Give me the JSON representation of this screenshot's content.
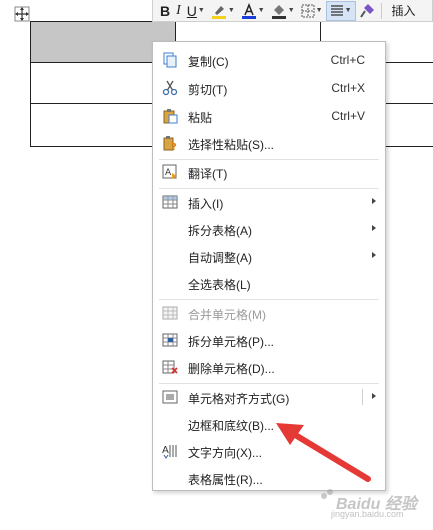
{
  "toolbar": {
    "bold": "B",
    "italic": "I",
    "underline": "U",
    "font_color_glyph": "A",
    "insert_label": "插入"
  },
  "menu": {
    "items": [
      {
        "label": "复制(C)",
        "shortcut": "Ctrl+C",
        "icon": "copy-icon"
      },
      {
        "label": "剪切(T)",
        "shortcut": "Ctrl+X",
        "icon": "scissors-icon"
      },
      {
        "label": "粘贴",
        "shortcut": "Ctrl+V",
        "icon": "paste-icon"
      },
      {
        "label": "选择性粘贴(S)...",
        "shortcut": "",
        "icon": "paste-special-icon"
      },
      {
        "label": "翻译(T)",
        "shortcut": "",
        "icon": "translate-icon"
      },
      {
        "label": "插入(I)",
        "shortcut": "",
        "icon": "table-insert-icon"
      },
      {
        "label": "拆分表格(A)",
        "shortcut": "",
        "icon": ""
      },
      {
        "label": "自动调整(A)",
        "shortcut": "",
        "icon": ""
      },
      {
        "label": "全选表格(L)",
        "shortcut": "",
        "icon": ""
      },
      {
        "label": "合并单元格(M)",
        "shortcut": "",
        "icon": "merge-cells-icon"
      },
      {
        "label": "拆分单元格(P)...",
        "shortcut": "",
        "icon": "split-cells-icon"
      },
      {
        "label": "删除单元格(D)...",
        "shortcut": "",
        "icon": "delete-cells-icon"
      },
      {
        "label": "单元格对齐方式(G)",
        "shortcut": "",
        "icon": "cell-align-icon"
      },
      {
        "label": "边框和底纹(B)...",
        "shortcut": "",
        "icon": ""
      },
      {
        "label": "文字方向(X)...",
        "shortcut": "",
        "icon": "text-direction-icon"
      },
      {
        "label": "表格属性(R)...",
        "shortcut": "",
        "icon": ""
      }
    ]
  },
  "watermark": {
    "text": "Baidu 经验",
    "url": "jingyan.baidu.com"
  },
  "colors": {
    "selected_cell": "#c6c6c6",
    "annotation_arrow": "#e53935",
    "font_color_bar": "#1a3fd6",
    "highlight_bar": "#f2d21a"
  }
}
